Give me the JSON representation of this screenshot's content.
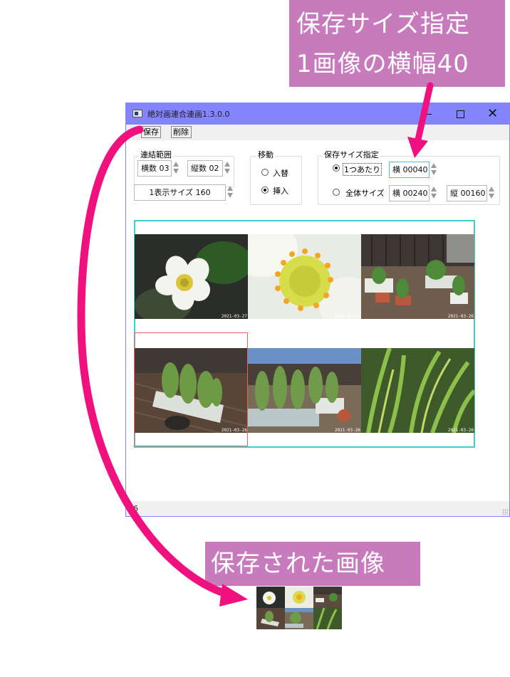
{
  "callouts": {
    "top_line1": "保存サイズ指定",
    "top_line2": "1画像の横幅40",
    "bottom": "保存された画像"
  },
  "window": {
    "title": "絶対画連合連画1.3.0.0",
    "controls": {
      "minimize": "",
      "maximize": "",
      "close": "✕"
    }
  },
  "toolbar": {
    "save_label": "保存",
    "delete_label": "削除"
  },
  "range_group": {
    "label": "連結範囲",
    "horizontal_count": "横数 03",
    "vertical_count": "縦数 02",
    "display_size": "1表示サイズ 160"
  },
  "move_group": {
    "label": "移動",
    "options": [
      {
        "label": "入替",
        "selected": false
      },
      {
        "label": "挿入",
        "selected": true
      }
    ]
  },
  "save_size_group": {
    "label": "保存サイズ指定",
    "per_image_label": "1つあたり",
    "per_image_selected": true,
    "per_image_width": "横 00040",
    "total_label": "全体サイズ",
    "total_selected": false,
    "total_width": "横 00240",
    "total_height": "縦 00160"
  },
  "preview": {
    "columns": 3,
    "rows": 2,
    "photos": [
      {
        "subject": "white strawberry flower",
        "date": "2021-03-27"
      },
      {
        "subject": "strawberry flower close-up",
        "date": "2021-03-27"
      },
      {
        "subject": "potted plants on deck",
        "date": "2021-03-26"
      },
      {
        "subject": "planter on wooden deck",
        "date": "2021-03-26"
      },
      {
        "subject": "planter with green shoots",
        "date": "2021-03-26"
      },
      {
        "subject": "green leaves close-up",
        "date": "2021-03-26"
      }
    ]
  },
  "status_bar": {
    "text": "16"
  },
  "colors": {
    "accent_magenta": "#f0117f",
    "callout_bg": "#c77bbd",
    "titlebar": "#8484ff",
    "preview_border": "#40d0c8",
    "selection_border": "#f06060"
  }
}
